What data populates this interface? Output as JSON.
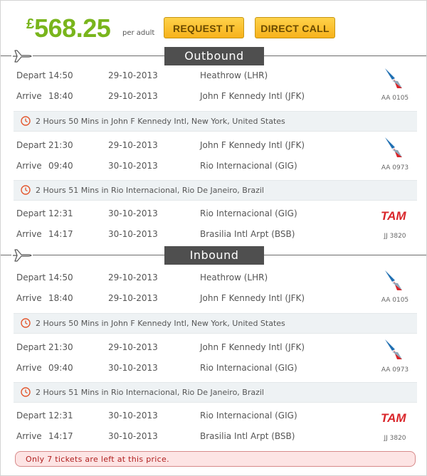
{
  "header": {
    "currency": "£",
    "price": "568.25",
    "per_adult": "per adult",
    "request_label": "REQUEST IT",
    "call_label": "DIRECT CALL"
  },
  "colors": {
    "price": "#79b51c",
    "button": "#f7b21b",
    "section_bar": "#4f4f4f",
    "layover_bg": "#eef2f4",
    "clock": "#e4572e",
    "notice_text": "#b02020"
  },
  "outbound": {
    "title": "Outbound",
    "legs": [
      {
        "depart_label": "Depart",
        "depart_time": "14:50",
        "depart_date": "29-10-2013",
        "depart_place": "Heathrow (LHR)",
        "arrive_label": "Arrive",
        "arrive_time": "18:40",
        "arrive_date": "29-10-2013",
        "arrive_place": "John F Kennedy Intl (JFK)",
        "airline_icon": "american-airlines-logo",
        "flight_no": "AA 0105"
      },
      {
        "depart_label": "Depart",
        "depart_time": "21:30",
        "depart_date": "29-10-2013",
        "depart_place": "John F Kennedy Intl (JFK)",
        "arrive_label": "Arrive",
        "arrive_time": "09:40",
        "arrive_date": "30-10-2013",
        "arrive_place": "Rio Internacional (GIG)",
        "airline_icon": "american-airlines-logo",
        "flight_no": "AA 0973"
      },
      {
        "depart_label": "Depart",
        "depart_time": "12:31",
        "depart_date": "30-10-2013",
        "depart_place": "Rio Internacional (GIG)",
        "arrive_label": "Arrive",
        "arrive_time": "14:17",
        "arrive_date": "30-10-2013",
        "arrive_place": "Brasilia Intl Arpt (BSB)",
        "airline_icon": "tam-logo",
        "airline_text": "TAM",
        "flight_no": "JJ 3820"
      }
    ],
    "layovers": [
      "2 Hours 50 Mins in John F Kennedy Intl, New York, United States",
      "2 Hours 51 Mins in Rio Internacional, Rio De Janeiro, Brazil"
    ]
  },
  "inbound": {
    "title": "Inbound",
    "legs": [
      {
        "depart_label": "Depart",
        "depart_time": "14:50",
        "depart_date": "29-10-2013",
        "depart_place": "Heathrow (LHR)",
        "arrive_label": "Arrive",
        "arrive_time": "18:40",
        "arrive_date": "29-10-2013",
        "arrive_place": "John F Kennedy Intl (JFK)",
        "airline_icon": "american-airlines-logo",
        "flight_no": "AA 0105"
      },
      {
        "depart_label": "Depart",
        "depart_time": "21:30",
        "depart_date": "29-10-2013",
        "depart_place": "John F Kennedy Intl (JFK)",
        "arrive_label": "Arrive",
        "arrive_time": "09:40",
        "arrive_date": "30-10-2013",
        "arrive_place": "Rio Internacional (GIG)",
        "airline_icon": "american-airlines-logo",
        "flight_no": "AA 0973"
      },
      {
        "depart_label": "Depart",
        "depart_time": "12:31",
        "depart_date": "30-10-2013",
        "depart_place": "Rio Internacional (GIG)",
        "arrive_label": "Arrive",
        "arrive_time": "14:17",
        "arrive_date": "30-10-2013",
        "arrive_place": "Brasilia Intl Arpt (BSB)",
        "airline_icon": "tam-logo",
        "airline_text": "TAM",
        "flight_no": "JJ 3820"
      }
    ],
    "layovers": [
      "2 Hours 50 Mins in John F Kennedy Intl, New York, United States",
      "2 Hours 51 Mins in Rio Internacional, Rio De Janeiro, Brazil"
    ]
  },
  "notice": "Only 7 tickets are left at this price."
}
